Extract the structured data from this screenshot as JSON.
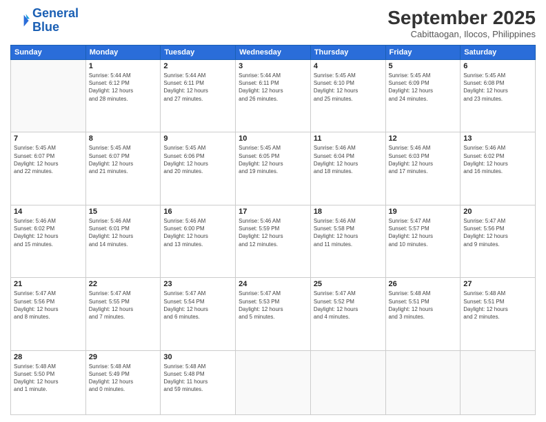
{
  "logo": {
    "line1": "General",
    "line2": "Blue"
  },
  "header": {
    "month": "September 2025",
    "location": "Cabittaogan, Ilocos, Philippines"
  },
  "weekdays": [
    "Sunday",
    "Monday",
    "Tuesday",
    "Wednesday",
    "Thursday",
    "Friday",
    "Saturday"
  ],
  "weeks": [
    [
      {
        "day": "",
        "info": ""
      },
      {
        "day": "1",
        "info": "Sunrise: 5:44 AM\nSunset: 6:12 PM\nDaylight: 12 hours\nand 28 minutes."
      },
      {
        "day": "2",
        "info": "Sunrise: 5:44 AM\nSunset: 6:11 PM\nDaylight: 12 hours\nand 27 minutes."
      },
      {
        "day": "3",
        "info": "Sunrise: 5:44 AM\nSunset: 6:11 PM\nDaylight: 12 hours\nand 26 minutes."
      },
      {
        "day": "4",
        "info": "Sunrise: 5:45 AM\nSunset: 6:10 PM\nDaylight: 12 hours\nand 25 minutes."
      },
      {
        "day": "5",
        "info": "Sunrise: 5:45 AM\nSunset: 6:09 PM\nDaylight: 12 hours\nand 24 minutes."
      },
      {
        "day": "6",
        "info": "Sunrise: 5:45 AM\nSunset: 6:08 PM\nDaylight: 12 hours\nand 23 minutes."
      }
    ],
    [
      {
        "day": "7",
        "info": "Sunrise: 5:45 AM\nSunset: 6:07 PM\nDaylight: 12 hours\nand 22 minutes."
      },
      {
        "day": "8",
        "info": "Sunrise: 5:45 AM\nSunset: 6:07 PM\nDaylight: 12 hours\nand 21 minutes."
      },
      {
        "day": "9",
        "info": "Sunrise: 5:45 AM\nSunset: 6:06 PM\nDaylight: 12 hours\nand 20 minutes."
      },
      {
        "day": "10",
        "info": "Sunrise: 5:45 AM\nSunset: 6:05 PM\nDaylight: 12 hours\nand 19 minutes."
      },
      {
        "day": "11",
        "info": "Sunrise: 5:46 AM\nSunset: 6:04 PM\nDaylight: 12 hours\nand 18 minutes."
      },
      {
        "day": "12",
        "info": "Sunrise: 5:46 AM\nSunset: 6:03 PM\nDaylight: 12 hours\nand 17 minutes."
      },
      {
        "day": "13",
        "info": "Sunrise: 5:46 AM\nSunset: 6:02 PM\nDaylight: 12 hours\nand 16 minutes."
      }
    ],
    [
      {
        "day": "14",
        "info": "Sunrise: 5:46 AM\nSunset: 6:02 PM\nDaylight: 12 hours\nand 15 minutes."
      },
      {
        "day": "15",
        "info": "Sunrise: 5:46 AM\nSunset: 6:01 PM\nDaylight: 12 hours\nand 14 minutes."
      },
      {
        "day": "16",
        "info": "Sunrise: 5:46 AM\nSunset: 6:00 PM\nDaylight: 12 hours\nand 13 minutes."
      },
      {
        "day": "17",
        "info": "Sunrise: 5:46 AM\nSunset: 5:59 PM\nDaylight: 12 hours\nand 12 minutes."
      },
      {
        "day": "18",
        "info": "Sunrise: 5:46 AM\nSunset: 5:58 PM\nDaylight: 12 hours\nand 11 minutes."
      },
      {
        "day": "19",
        "info": "Sunrise: 5:47 AM\nSunset: 5:57 PM\nDaylight: 12 hours\nand 10 minutes."
      },
      {
        "day": "20",
        "info": "Sunrise: 5:47 AM\nSunset: 5:56 PM\nDaylight: 12 hours\nand 9 minutes."
      }
    ],
    [
      {
        "day": "21",
        "info": "Sunrise: 5:47 AM\nSunset: 5:56 PM\nDaylight: 12 hours\nand 8 minutes."
      },
      {
        "day": "22",
        "info": "Sunrise: 5:47 AM\nSunset: 5:55 PM\nDaylight: 12 hours\nand 7 minutes."
      },
      {
        "day": "23",
        "info": "Sunrise: 5:47 AM\nSunset: 5:54 PM\nDaylight: 12 hours\nand 6 minutes."
      },
      {
        "day": "24",
        "info": "Sunrise: 5:47 AM\nSunset: 5:53 PM\nDaylight: 12 hours\nand 5 minutes."
      },
      {
        "day": "25",
        "info": "Sunrise: 5:47 AM\nSunset: 5:52 PM\nDaylight: 12 hours\nand 4 minutes."
      },
      {
        "day": "26",
        "info": "Sunrise: 5:48 AM\nSunset: 5:51 PM\nDaylight: 12 hours\nand 3 minutes."
      },
      {
        "day": "27",
        "info": "Sunrise: 5:48 AM\nSunset: 5:51 PM\nDaylight: 12 hours\nand 2 minutes."
      }
    ],
    [
      {
        "day": "28",
        "info": "Sunrise: 5:48 AM\nSunset: 5:50 PM\nDaylight: 12 hours\nand 1 minute."
      },
      {
        "day": "29",
        "info": "Sunrise: 5:48 AM\nSunset: 5:49 PM\nDaylight: 12 hours\nand 0 minutes."
      },
      {
        "day": "30",
        "info": "Sunrise: 5:48 AM\nSunset: 5:48 PM\nDaylight: 11 hours\nand 59 minutes."
      },
      {
        "day": "",
        "info": ""
      },
      {
        "day": "",
        "info": ""
      },
      {
        "day": "",
        "info": ""
      },
      {
        "day": "",
        "info": ""
      }
    ]
  ]
}
